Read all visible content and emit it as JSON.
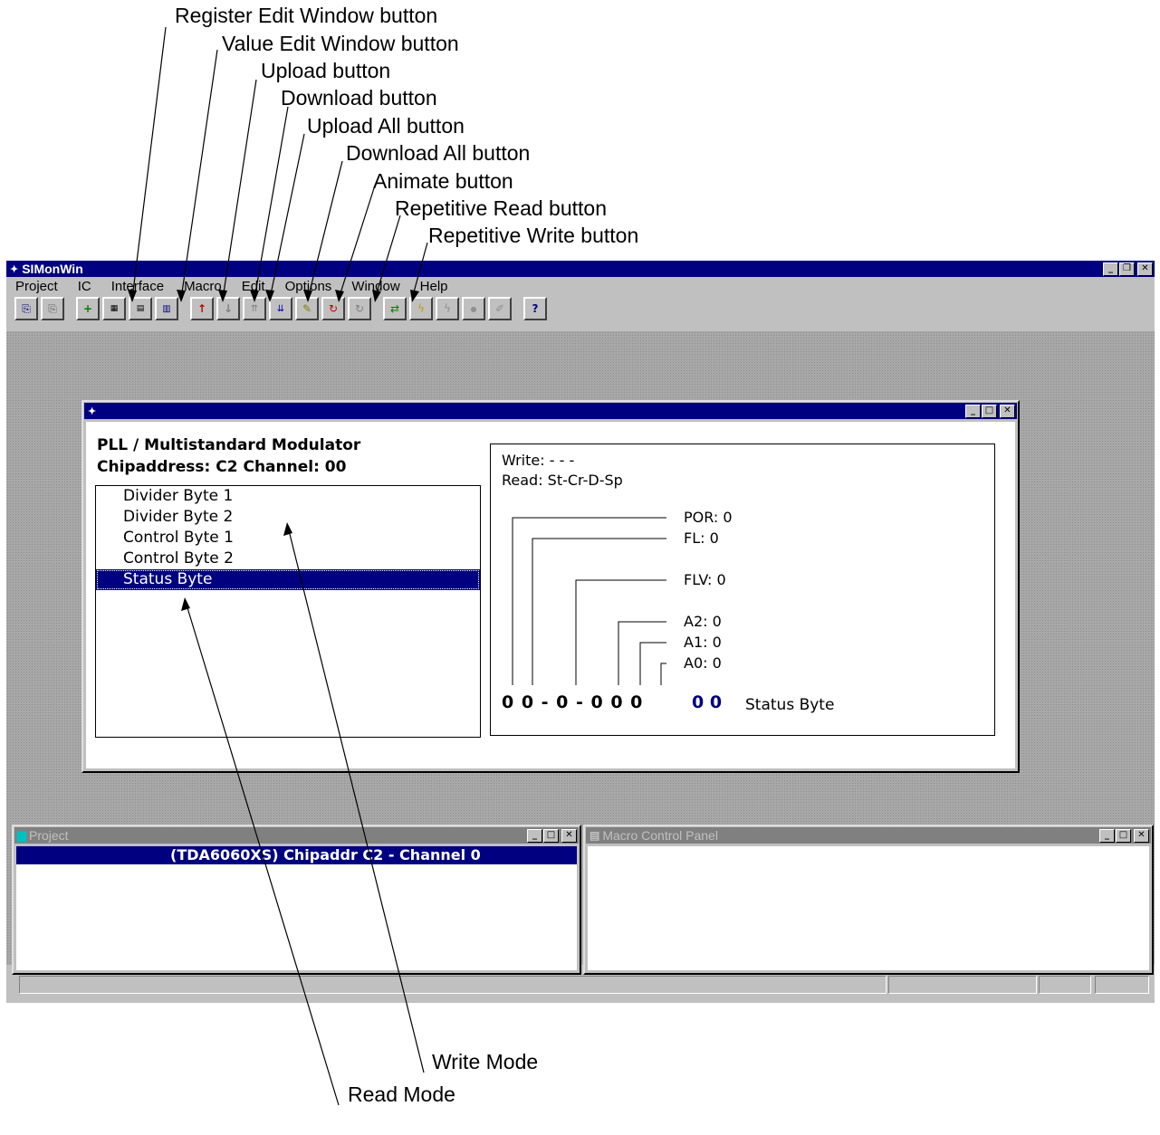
{
  "callouts": {
    "register_edit_window": "Register Edit Window button",
    "value_edit_window": "Value Edit Window button",
    "upload": "Upload button",
    "download": "Download button",
    "upload_all": "Upload All button",
    "download_all": "Download All button",
    "animate": "Animate button",
    "repetitive_read": "Repetitive Read button",
    "repetitive_write": "Repetitive Write button",
    "write_mode": "Write Mode",
    "read_mode": "Read Mode"
  },
  "app": {
    "title": "SIMonWin",
    "menu": [
      "Project",
      "IC",
      "Interface",
      "Macro",
      "Edit",
      "Options",
      "Window",
      "Help"
    ]
  },
  "register_window": {
    "device": "PLL / Multistandard Modulator",
    "address_line": "Chipaddress: C2  Channel: 00",
    "registers": [
      "Divider Byte 1",
      "Divider Byte 2",
      "Control Byte 1",
      "Control Byte 2",
      "Status Byte"
    ],
    "selected_index": 4,
    "write_line": "Write: - - -",
    "read_line": "Read: St-Cr-D-Sp",
    "bit_fields": [
      {
        "label": "POR: 0"
      },
      {
        "label": "FL: 0"
      },
      {
        "label": "FLV: 0"
      },
      {
        "label": "A2: 0"
      },
      {
        "label": "A1: 0"
      },
      {
        "label": "A0: 0"
      }
    ],
    "bit_pattern": "0 0 - 0 - 0 0 0",
    "hex_value": "0 0",
    "register_name": "Status Byte"
  },
  "project_window": {
    "title": "Project",
    "selected_row": "(TDA6060XS)  Chipaddr C2 - Channel 0"
  },
  "macro_window": {
    "title": "Macro Control Panel"
  },
  "colors": {
    "title_active": "#000080",
    "title_inactive": "#808080",
    "face": "#c0c0c0",
    "hex_value": "#000080"
  }
}
